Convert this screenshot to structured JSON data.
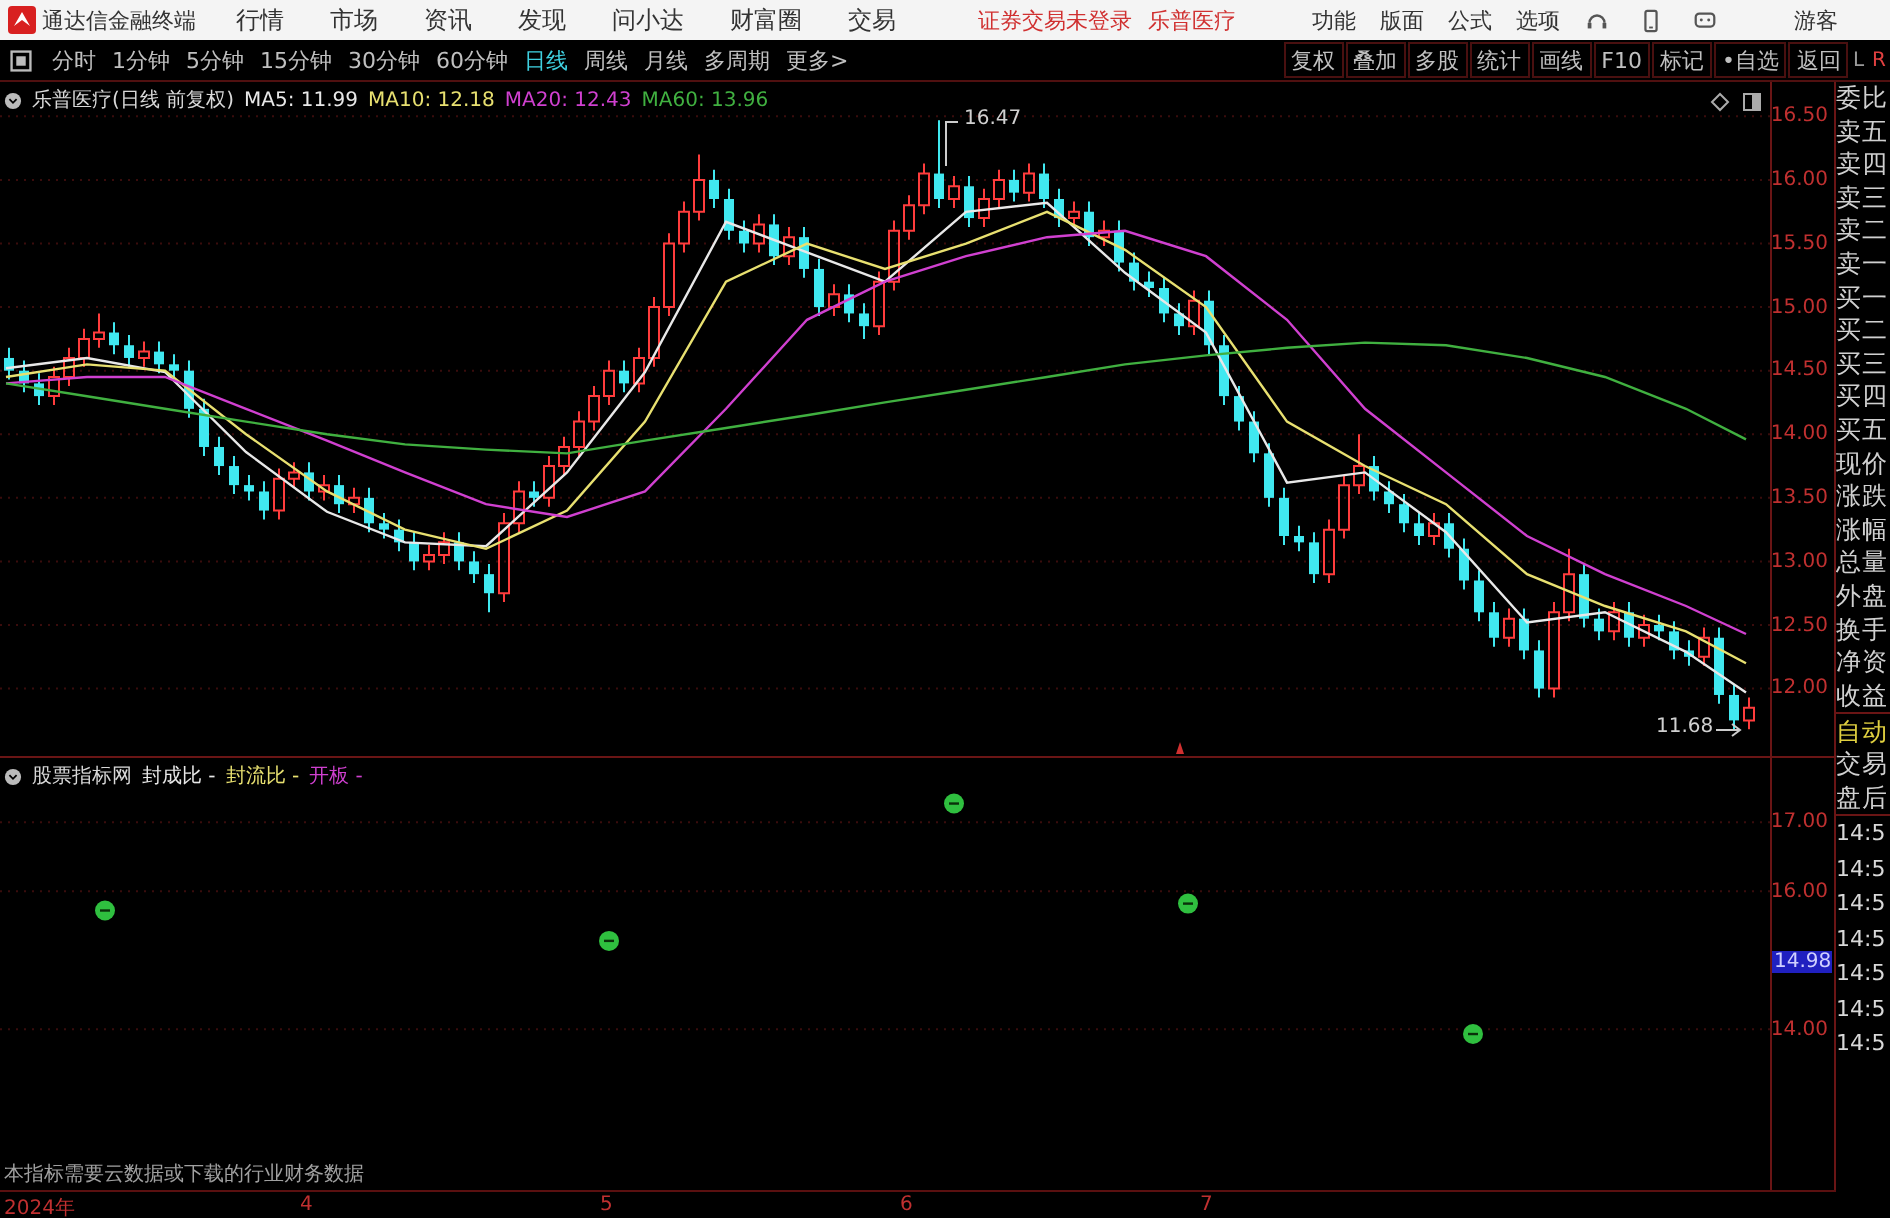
{
  "app_title": "通达信金融终端",
  "menu": [
    "行情",
    "市场",
    "资讯",
    "发现",
    "问小达",
    "财富圈",
    "交易"
  ],
  "status_notices": [
    "证券交易未登录",
    "乐普医疗"
  ],
  "menu_right": [
    "功能",
    "版面",
    "公式",
    "选项"
  ],
  "user": "游客",
  "periods": [
    {
      "label": "分时",
      "selected": false
    },
    {
      "label": "1分钟",
      "selected": false
    },
    {
      "label": "5分钟",
      "selected": false
    },
    {
      "label": "15分钟",
      "selected": false
    },
    {
      "label": "30分钟",
      "selected": false
    },
    {
      "label": "60分钟",
      "selected": false
    },
    {
      "label": "日线",
      "selected": true
    },
    {
      "label": "周线",
      "selected": false
    },
    {
      "label": "月线",
      "selected": false
    },
    {
      "label": "多周期",
      "selected": false
    },
    {
      "label": "更多>",
      "selected": false
    }
  ],
  "tools": [
    "复权",
    "叠加",
    "多股",
    "统计",
    "画线",
    "F10",
    "标记",
    "•自选",
    "返回"
  ],
  "lr_labels": [
    "L",
    "R"
  ],
  "main_chart": {
    "title": "乐普医疗(日线 前复权)",
    "indicators": [
      {
        "label": "MA5: 11.99",
        "color": "#e8e8e8"
      },
      {
        "label": "MA10: 12.18",
        "color": "#e8e070"
      },
      {
        "label": "MA20: 12.43",
        "color": "#d040d0"
      },
      {
        "label": "MA60: 13.96",
        "color": "#40b040"
      }
    ],
    "high_label": "16.47",
    "low_label": "11.68",
    "chart_data": {
      "type": "candlestick",
      "xlim": [
        3.0,
        9.12
      ],
      "ylim": [
        11.47,
        16.77
      ],
      "grid": true,
      "x": [
        3.03,
        3.08,
        3.13,
        3.18,
        3.23,
        3.28,
        3.33,
        3.38,
        3.43,
        3.48,
        3.53,
        3.58,
        3.63,
        3.68,
        3.73,
        3.78,
        3.83,
        3.88,
        3.93,
        3.98,
        4.03,
        4.08,
        4.13,
        4.18,
        4.23,
        4.28,
        4.33,
        4.38,
        4.43,
        4.48,
        4.53,
        4.58,
        4.63,
        4.68,
        4.73,
        4.78,
        4.83,
        4.88,
        4.93,
        4.98,
        5.03,
        5.08,
        5.13,
        5.18,
        5.23,
        5.28,
        5.33,
        5.38,
        5.43,
        5.48,
        5.53,
        5.58,
        5.63,
        5.68,
        5.73,
        5.78,
        5.83,
        5.88,
        5.93,
        5.98,
        6.03,
        6.08,
        6.13,
        6.18,
        6.23,
        6.28,
        6.33,
        6.38,
        6.43,
        6.48,
        6.53,
        6.58,
        6.63,
        6.68,
        6.73,
        6.78,
        6.83,
        6.88,
        6.93,
        6.98,
        7.03,
        7.08,
        7.13,
        7.18,
        7.23,
        7.28,
        7.33,
        7.38,
        7.43,
        7.48,
        7.53,
        7.58,
        7.63,
        7.68,
        7.73,
        7.78,
        7.83,
        7.88,
        7.93,
        7.98,
        8.03,
        8.08,
        8.13,
        8.18,
        8.23,
        8.28,
        8.33,
        8.38,
        8.43,
        8.48,
        8.53,
        8.58,
        8.63,
        8.68,
        8.73,
        8.78,
        8.83
      ],
      "ohlc": [
        [
          14.6,
          14.68,
          14.43,
          14.5
        ],
        [
          14.5,
          14.58,
          14.33,
          14.4
        ],
        [
          14.4,
          14.48,
          14.23,
          14.3
        ],
        [
          14.3,
          14.53,
          14.23,
          14.45
        ],
        [
          14.45,
          14.68,
          14.38,
          14.6
        ],
        [
          14.6,
          14.83,
          14.53,
          14.75
        ],
        [
          14.75,
          14.95,
          14.68,
          14.8
        ],
        [
          14.8,
          14.88,
          14.63,
          14.7
        ],
        [
          14.7,
          14.78,
          14.53,
          14.6
        ],
        [
          14.6,
          14.73,
          14.53,
          14.65
        ],
        [
          14.65,
          14.73,
          14.48,
          14.55
        ],
        [
          14.55,
          14.63,
          14.43,
          14.5
        ],
        [
          14.5,
          14.58,
          14.13,
          14.2
        ],
        [
          14.2,
          14.28,
          13.83,
          13.9
        ],
        [
          13.9,
          13.98,
          13.68,
          13.75
        ],
        [
          13.75,
          13.83,
          13.53,
          13.6
        ],
        [
          13.6,
          13.68,
          13.48,
          13.55
        ],
        [
          13.55,
          13.63,
          13.33,
          13.4
        ],
        [
          13.4,
          13.73,
          13.33,
          13.65
        ],
        [
          13.65,
          13.78,
          13.58,
          13.7
        ],
        [
          13.7,
          13.78,
          13.48,
          13.55
        ],
        [
          13.55,
          13.68,
          13.48,
          13.6
        ],
        [
          13.6,
          13.68,
          13.38,
          13.45
        ],
        [
          13.45,
          13.58,
          13.38,
          13.5
        ],
        [
          13.5,
          13.58,
          13.23,
          13.3
        ],
        [
          13.3,
          13.38,
          13.18,
          13.25
        ],
        [
          13.25,
          13.33,
          13.08,
          13.15
        ],
        [
          13.15,
          13.23,
          12.93,
          13.0
        ],
        [
          13.0,
          13.13,
          12.93,
          13.05
        ],
        [
          13.05,
          13.23,
          12.98,
          13.15
        ],
        [
          13.15,
          13.23,
          12.93,
          13.0
        ],
        [
          13.0,
          13.08,
          12.83,
          12.9
        ],
        [
          12.9,
          12.98,
          12.6,
          12.75
        ],
        [
          12.75,
          13.38,
          12.68,
          13.3
        ],
        [
          13.3,
          13.63,
          13.23,
          13.55
        ],
        [
          13.55,
          13.63,
          13.43,
          13.5
        ],
        [
          13.5,
          13.83,
          13.43,
          13.75
        ],
        [
          13.75,
          13.98,
          13.68,
          13.9
        ],
        [
          13.9,
          14.18,
          13.83,
          14.1
        ],
        [
          14.1,
          14.38,
          14.03,
          14.3
        ],
        [
          14.3,
          14.58,
          14.23,
          14.5
        ],
        [
          14.5,
          14.58,
          14.33,
          14.4
        ],
        [
          14.4,
          14.68,
          14.33,
          14.6
        ],
        [
          14.6,
          15.08,
          14.53,
          15.0
        ],
        [
          15.0,
          15.58,
          14.93,
          15.5
        ],
        [
          15.5,
          15.83,
          15.43,
          15.75
        ],
        [
          15.75,
          16.2,
          15.68,
          16.0
        ],
        [
          16.0,
          16.08,
          15.78,
          15.85
        ],
        [
          15.85,
          15.93,
          15.53,
          15.6
        ],
        [
          15.6,
          15.68,
          15.43,
          15.5
        ],
        [
          15.5,
          15.73,
          15.43,
          15.65
        ],
        [
          15.65,
          15.73,
          15.33,
          15.4
        ],
        [
          15.4,
          15.63,
          15.33,
          15.55
        ],
        [
          15.55,
          15.63,
          15.23,
          15.3
        ],
        [
          15.3,
          15.38,
          14.93,
          15.0
        ],
        [
          15.0,
          15.18,
          14.93,
          15.1
        ],
        [
          15.1,
          15.18,
          14.88,
          14.95
        ],
        [
          14.95,
          15.03,
          14.75,
          14.85
        ],
        [
          14.85,
          15.28,
          14.78,
          15.2
        ],
        [
          15.2,
          15.68,
          15.13,
          15.6
        ],
        [
          15.6,
          15.88,
          15.53,
          15.8
        ],
        [
          15.8,
          16.13,
          15.73,
          16.05
        ],
        [
          16.05,
          16.47,
          15.78,
          15.85
        ],
        [
          15.85,
          16.03,
          15.78,
          15.95
        ],
        [
          15.95,
          16.03,
          15.63,
          15.7
        ],
        [
          15.7,
          15.93,
          15.63,
          15.85
        ],
        [
          15.85,
          16.08,
          15.78,
          16.0
        ],
        [
          16.0,
          16.08,
          15.83,
          15.9
        ],
        [
          15.9,
          16.13,
          15.83,
          16.05
        ],
        [
          16.05,
          16.13,
          15.78,
          15.85
        ],
        [
          15.85,
          15.93,
          15.63,
          15.7
        ],
        [
          15.7,
          15.83,
          15.63,
          15.75
        ],
        [
          15.75,
          15.83,
          15.48,
          15.55
        ],
        [
          15.55,
          15.68,
          15.48,
          15.6
        ],
        [
          15.6,
          15.68,
          15.28,
          15.35
        ],
        [
          15.35,
          15.43,
          15.13,
          15.2
        ],
        [
          15.2,
          15.28,
          15.08,
          15.15
        ],
        [
          15.15,
          15.23,
          14.88,
          14.95
        ],
        [
          14.95,
          15.03,
          14.78,
          14.85
        ],
        [
          14.85,
          15.13,
          14.78,
          15.05
        ],
        [
          15.05,
          15.13,
          14.63,
          14.7
        ],
        [
          14.7,
          14.78,
          14.23,
          14.3
        ],
        [
          14.3,
          14.38,
          14.03,
          14.1
        ],
        [
          14.1,
          14.18,
          13.78,
          13.85
        ],
        [
          13.85,
          13.93,
          13.43,
          13.5
        ],
        [
          13.5,
          13.58,
          13.13,
          13.2
        ],
        [
          13.2,
          13.28,
          13.08,
          13.15
        ],
        [
          13.15,
          13.23,
          12.83,
          12.9
        ],
        [
          12.9,
          13.33,
          12.83,
          13.25
        ],
        [
          13.25,
          13.68,
          13.18,
          13.6
        ],
        [
          13.6,
          14.0,
          13.53,
          13.75
        ],
        [
          13.75,
          13.83,
          13.48,
          13.55
        ],
        [
          13.55,
          13.63,
          13.38,
          13.45
        ],
        [
          13.45,
          13.53,
          13.23,
          13.3
        ],
        [
          13.3,
          13.38,
          13.13,
          13.2
        ],
        [
          13.2,
          13.38,
          13.13,
          13.3
        ],
        [
          13.3,
          13.38,
          13.03,
          13.1
        ],
        [
          13.1,
          13.18,
          12.78,
          12.85
        ],
        [
          12.85,
          12.93,
          12.53,
          12.6
        ],
        [
          12.6,
          12.68,
          12.33,
          12.4
        ],
        [
          12.4,
          12.63,
          12.33,
          12.55
        ],
        [
          12.55,
          12.63,
          12.23,
          12.3
        ],
        [
          12.3,
          12.38,
          11.93,
          12.0
        ],
        [
          12.0,
          12.68,
          11.93,
          12.6
        ],
        [
          12.6,
          13.1,
          12.53,
          12.9
        ],
        [
          12.9,
          12.98,
          12.48,
          12.55
        ],
        [
          12.55,
          12.63,
          12.38,
          12.45
        ],
        [
          12.45,
          12.68,
          12.38,
          12.6
        ],
        [
          12.6,
          12.68,
          12.33,
          12.4
        ],
        [
          12.4,
          12.58,
          12.33,
          12.5
        ],
        [
          12.5,
          12.58,
          12.38,
          12.45
        ],
        [
          12.45,
          12.53,
          12.23,
          12.3
        ],
        [
          12.3,
          12.38,
          12.18,
          12.25
        ],
        [
          12.25,
          12.48,
          12.18,
          12.4
        ],
        [
          12.4,
          12.48,
          11.88,
          11.95
        ],
        [
          11.95,
          12.03,
          11.68,
          11.75
        ],
        [
          11.75,
          11.93,
          11.68,
          11.85
        ]
      ],
      "yticks": [
        {
          "value": 16.5,
          "label": "16.50"
        },
        {
          "value": 16,
          "label": "16.00"
        },
        {
          "value": 15.5,
          "label": "15.50"
        },
        {
          "value": 15,
          "label": "15.00"
        },
        {
          "value": 14.5,
          "label": "14.50"
        },
        {
          "value": 14,
          "label": "14.00"
        },
        {
          "value": 13.5,
          "label": "13.50"
        },
        {
          "value": 13,
          "label": "13.00"
        },
        {
          "value": 12.5,
          "label": "12.50"
        },
        {
          "value": 12,
          "label": "12.00"
        }
      ],
      "series": [
        {
          "type": "line",
          "color": "#e8e8e8",
          "x": [
            3.02,
            3.29,
            3.55,
            3.82,
            4.09,
            4.35,
            4.62,
            4.89,
            5.15,
            5.42,
            5.69,
            5.95,
            6.22,
            6.49,
            6.75,
            7.02,
            7.29,
            7.55,
            7.82,
            8.09,
            8.35,
            8.62,
            8.82
          ],
          "values": [
            14.52,
            14.6,
            14.49,
            13.86,
            13.39,
            13.15,
            13.12,
            13.7,
            14.49,
            15.67,
            15.43,
            15.2,
            15.75,
            15.82,
            15.27,
            14.8,
            13.62,
            13.7,
            13.23,
            12.52,
            12.6,
            12.29,
            11.97
          ]
        },
        {
          "type": "line",
          "color": "#e8e070",
          "x": [
            3.02,
            3.29,
            3.55,
            3.82,
            4.09,
            4.35,
            4.62,
            4.89,
            5.15,
            5.42,
            5.69,
            5.95,
            6.22,
            6.49,
            6.75,
            7.02,
            7.29,
            7.55,
            7.82,
            8.09,
            8.35,
            8.62,
            8.82
          ],
          "values": [
            14.45,
            14.55,
            14.5,
            14.0,
            13.55,
            13.25,
            13.1,
            13.4,
            14.1,
            15.2,
            15.5,
            15.3,
            15.5,
            15.75,
            15.45,
            15.0,
            14.1,
            13.75,
            13.45,
            12.9,
            12.65,
            12.45,
            12.2
          ]
        },
        {
          "type": "line",
          "color": "#d040d0",
          "x": [
            3.02,
            3.29,
            3.55,
            3.82,
            4.09,
            4.35,
            4.62,
            4.89,
            5.15,
            5.42,
            5.69,
            5.95,
            6.22,
            6.49,
            6.75,
            7.02,
            7.29,
            7.55,
            7.82,
            8.09,
            8.35,
            8.62,
            8.82
          ],
          "values": [
            14.4,
            14.45,
            14.45,
            14.2,
            13.95,
            13.7,
            13.45,
            13.35,
            13.55,
            14.2,
            14.9,
            15.2,
            15.4,
            15.55,
            15.6,
            15.4,
            14.9,
            14.2,
            13.7,
            13.2,
            12.9,
            12.65,
            12.43
          ]
        },
        {
          "type": "line",
          "color": "#40b040",
          "x": [
            3.02,
            3.29,
            3.55,
            3.82,
            4.09,
            4.35,
            4.62,
            4.89,
            5.15,
            5.42,
            5.69,
            5.95,
            6.22,
            6.49,
            6.75,
            7.02,
            7.29,
            7.55,
            7.82,
            8.09,
            8.35,
            8.62,
            8.82
          ],
          "values": [
            14.4,
            14.3,
            14.2,
            14.1,
            14.0,
            13.92,
            13.88,
            13.85,
            13.95,
            14.05,
            14.15,
            14.25,
            14.35,
            14.45,
            14.55,
            14.62,
            14.68,
            14.72,
            14.7,
            14.6,
            14.45,
            14.2,
            13.96
          ]
        }
      ]
    }
  },
  "sub_chart": {
    "title": "股票指标网",
    "indicators": [
      {
        "label": "封成比 -",
        "color": "#e8e8e8"
      },
      {
        "label": "封流比 -",
        "color": "#e8e070"
      },
      {
        "label": "开板 -",
        "color": "#d040d0"
      }
    ],
    "current_value": "14.98",
    "year_label": "2024年",
    "note": "本指标需要云数据或下载的行业财务数据",
    "chart_data": {
      "type": "scatter",
      "xlim": [
        3.0,
        9.12
      ],
      "ylim": [
        11.67,
        17.93
      ],
      "grid": true,
      "xticks": [
        {
          "value": 4,
          "label": "4"
        },
        {
          "value": 5,
          "label": "5"
        },
        {
          "value": 6,
          "label": "6"
        },
        {
          "value": 7,
          "label": "7"
        }
      ],
      "yticks": [
        {
          "value": 14,
          "label": "14.00"
        },
        {
          "value": 16,
          "label": "16.00"
        },
        {
          "value": 17,
          "label": "17.00"
        }
      ],
      "series": [
        {
          "color": "#2fbf3f",
          "x": [
            3.35,
            5.03,
            6.18,
            6.96,
            7.91
          ],
          "values": [
            15.72,
            15.28,
            17.27,
            15.82,
            13.93
          ]
        }
      ]
    }
  },
  "quote_labels": [
    "委比",
    "卖五",
    "卖四",
    "卖三",
    "卖二",
    "卖一",
    "买一",
    "买二",
    "买三",
    "买四",
    "买五",
    "现价",
    "涨跌",
    "涨幅",
    "总量",
    "外盘",
    "换手",
    "净资",
    "收益"
  ],
  "mode_button": "自动",
  "trade_labels": [
    "交易",
    "盘后"
  ],
  "times": [
    "14:5",
    "14:5",
    "14:5",
    "14:5",
    "14:5",
    "14:5",
    "14:5"
  ]
}
